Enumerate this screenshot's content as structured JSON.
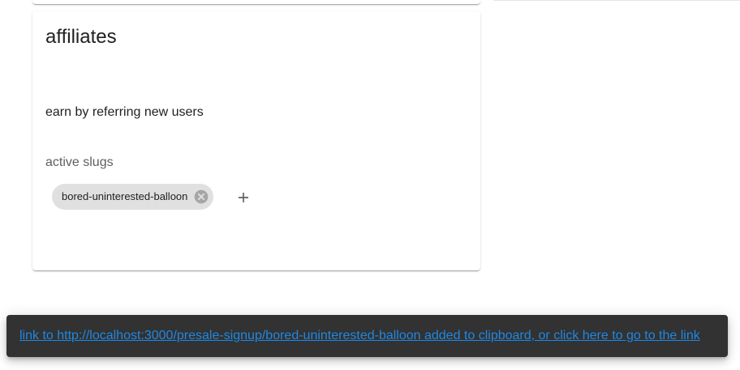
{
  "card": {
    "title": "affiliates",
    "description": "earn by referring new users",
    "slugs_label": "active slugs",
    "slugs": [
      "bored-uninterested-balloon"
    ]
  },
  "icons": {
    "chip_delete": "cancel-circle-icon",
    "add": "plus-icon"
  },
  "snackbar": {
    "message": "link to http://localhost:3000/presale-signup/bored-uninterested-balloon added to clipboard, or click here to go to the link"
  },
  "colors": {
    "link": "#1e88e5",
    "snackbar_bg": "#323232",
    "chip_bg": "#e0e0e0"
  }
}
